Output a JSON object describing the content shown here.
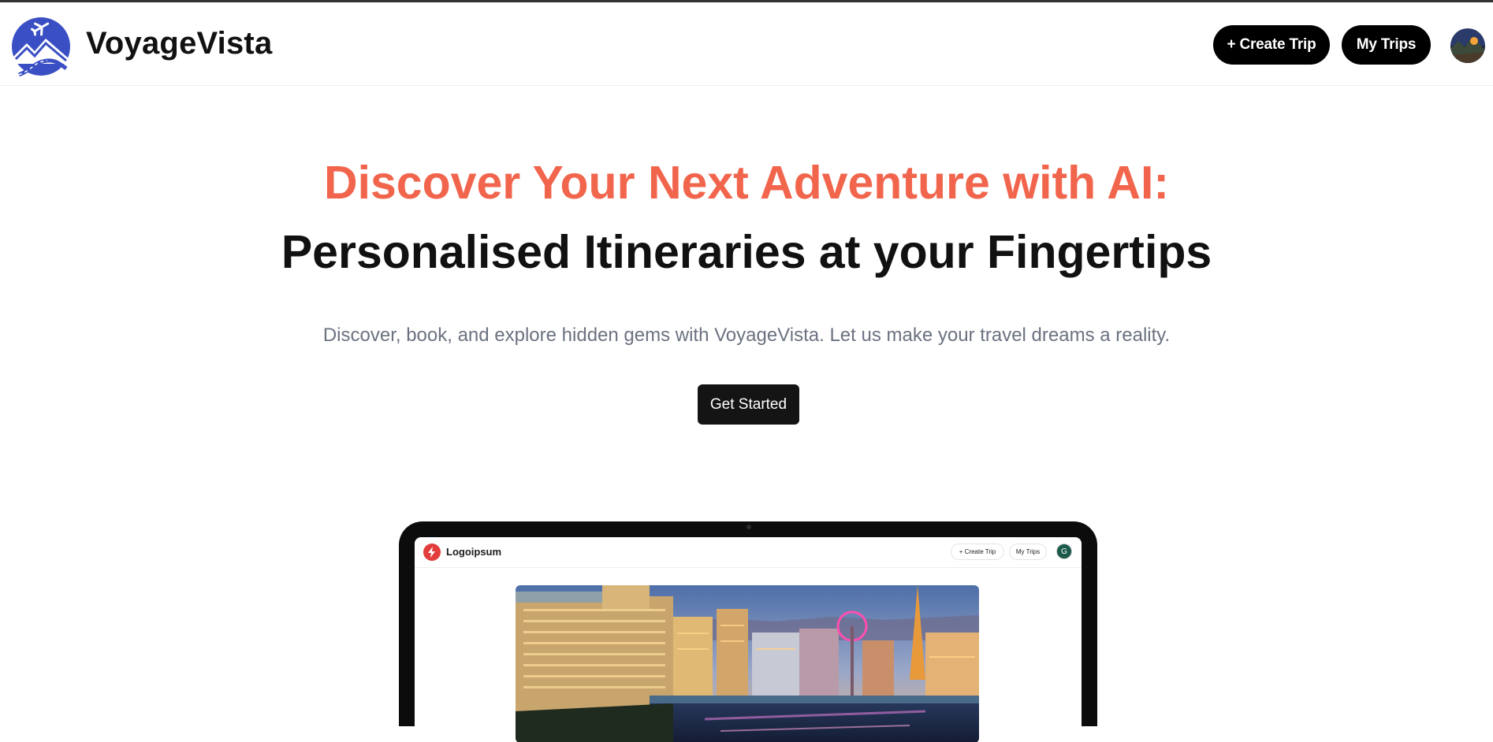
{
  "header": {
    "brand": "VoyageVista",
    "create_trip_label": "+ Create Trip",
    "my_trips_label": "My Trips"
  },
  "hero": {
    "title": "Discover Your Next Adventure with AI:",
    "subtitle": "Personalised Itineraries at your Fingertips",
    "description": "Discover, book, and explore hidden gems with VoyageVista. Let us make your travel dreams a reality.",
    "cta_label": "Get Started"
  },
  "mockup": {
    "brand": "Logoipsum",
    "create_trip_label": "+ Create Trip",
    "my_trips_label": "My Trips",
    "avatar_initial": "G"
  },
  "colors": {
    "accent": "#f2654d",
    "logo_blue": "#3a4fc4",
    "button_dark": "#000000"
  },
  "icons": {
    "logo": "voyagevista-plane-mountains-logo-icon",
    "mockup_logo": "lightning-bolt-icon"
  }
}
